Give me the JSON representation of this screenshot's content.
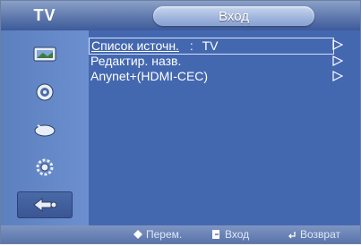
{
  "header": {
    "section": "TV",
    "title": "Вход"
  },
  "sidebar": {
    "items": [
      {
        "icon": "picture-icon",
        "active": false
      },
      {
        "icon": "sound-icon",
        "active": false
      },
      {
        "icon": "channel-icon",
        "active": false
      },
      {
        "icon": "setup-icon",
        "active": false
      },
      {
        "icon": "input-icon",
        "active": true
      }
    ]
  },
  "menu": {
    "items": [
      {
        "label": "Список источн.",
        "separator": ":",
        "value": "TV"
      },
      {
        "label": "Редактир. назв.",
        "separator": "",
        "value": ""
      },
      {
        "label": "Anynet+(HDMI-CEC)",
        "separator": "",
        "value": ""
      }
    ]
  },
  "footer": {
    "move": "Перем.",
    "enter": "Вход",
    "return": "Возврат"
  },
  "colors": {
    "background": "#4468b0",
    "sidebar": "#6c8fcf",
    "text": "#ffffff"
  }
}
